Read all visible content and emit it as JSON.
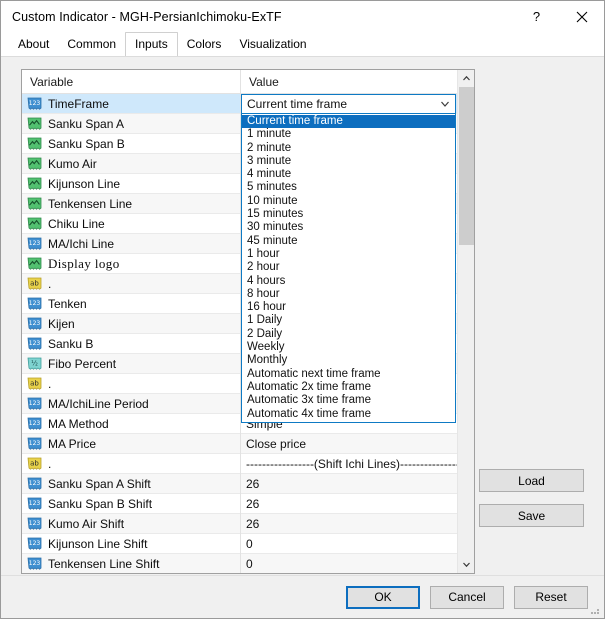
{
  "window": {
    "title": "Custom Indicator - MGH-PersianIchimoku-ExTF",
    "help_label": "?",
    "close_label": "✕"
  },
  "tabs": [
    {
      "label": "About",
      "active": false
    },
    {
      "label": "Common",
      "active": false
    },
    {
      "label": "Inputs",
      "active": true
    },
    {
      "label": "Colors",
      "active": false
    },
    {
      "label": "Visualization",
      "active": false
    }
  ],
  "grid": {
    "headers": {
      "variable": "Variable",
      "value": "Value"
    },
    "rows": [
      {
        "icon": "int-123-icon",
        "label": "TimeFrame",
        "value": "",
        "selected": true
      },
      {
        "icon": "chart-line-icon",
        "label": "Sanku Span A",
        "value": ""
      },
      {
        "icon": "chart-line-icon",
        "label": "Sanku Span B",
        "value": ""
      },
      {
        "icon": "chart-line-icon",
        "label": "Kumo Air",
        "value": ""
      },
      {
        "icon": "chart-line-icon",
        "label": "Kijunson Line",
        "value": ""
      },
      {
        "icon": "chart-line-icon",
        "label": "Tenkensen Line",
        "value": ""
      },
      {
        "icon": "chart-line-icon",
        "label": "Chiku Line",
        "value": ""
      },
      {
        "icon": "int-123-icon",
        "label": "MA/Ichi Line",
        "value": ""
      },
      {
        "icon": "chart-line-icon",
        "label": "Display logo",
        "value": "",
        "serif": true
      },
      {
        "icon": "string-ab-icon",
        "label": ".",
        "value": ""
      },
      {
        "icon": "int-123-icon",
        "label": "Tenken",
        "value": ""
      },
      {
        "icon": "int-123-icon",
        "label": "Kijen",
        "value": ""
      },
      {
        "icon": "int-123-icon",
        "label": "Sanku B",
        "value": ""
      },
      {
        "icon": "double-half-icon",
        "label": "Fibo Percent",
        "value": ""
      },
      {
        "icon": "string-ab-icon",
        "label": ".",
        "value": ""
      },
      {
        "icon": "int-123-icon",
        "label": "MA/IchiLine Period",
        "value": ""
      },
      {
        "icon": "int-123-icon",
        "label": "MA Method",
        "value": "Simple"
      },
      {
        "icon": "int-123-icon",
        "label": "MA Price",
        "value": "Close price"
      },
      {
        "icon": "string-ab-icon",
        "label": ".",
        "value": "-----------------(Shift Ichi Lines)------------------"
      },
      {
        "icon": "int-123-icon",
        "label": "Sanku Span A Shift",
        "value": "26"
      },
      {
        "icon": "int-123-icon",
        "label": "Sanku Span B Shift",
        "value": "26"
      },
      {
        "icon": "int-123-icon",
        "label": "Kumo Air Shift",
        "value": "26"
      },
      {
        "icon": "int-123-icon",
        "label": "Kijunson Line Shift",
        "value": "0"
      },
      {
        "icon": "int-123-icon",
        "label": "Tenkensen Line Shift",
        "value": "0"
      }
    ]
  },
  "combobox": {
    "selected_value": "Current time frame",
    "options": [
      "Current time frame",
      "1 minute",
      "2 minute",
      "3 minute",
      "4 minute",
      "5 minutes",
      "10 minute",
      "15 minutes",
      "30 minutes",
      "45 minute",
      "1 hour",
      "2 hour",
      "4 hours",
      "8 hour",
      "16 hour",
      "1 Daily",
      "2 Daily",
      "Weekly",
      "Monthly",
      "Automatic next time frame",
      "Automatic 2x time frame",
      "Automatic 3x time frame",
      "Automatic 4x time frame"
    ]
  },
  "side_buttons": {
    "load": "Load",
    "save": "Save"
  },
  "footer_buttons": {
    "ok": "OK",
    "cancel": "Cancel",
    "reset": "Reset"
  },
  "colors": {
    "accent": "#0d6ebf",
    "selection_row": "#cfe8fb",
    "button_face": "#e1e1e1",
    "icon_int": "#3f8fd0",
    "icon_line": "#52c170",
    "icon_string": "#e8d24a",
    "icon_double": "#7fd3d0"
  }
}
